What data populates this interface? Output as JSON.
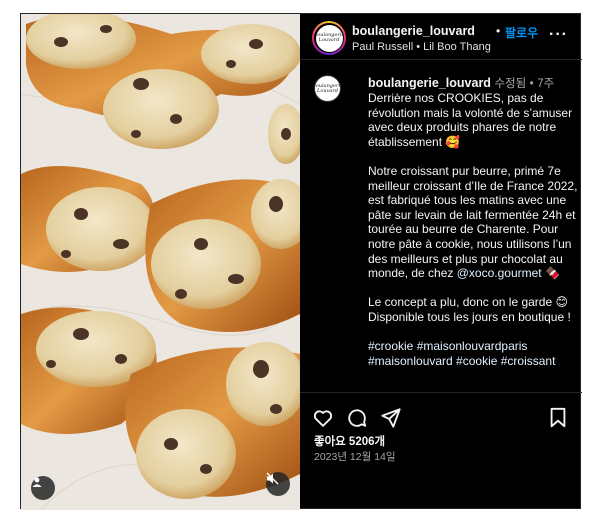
{
  "post": {
    "username": "boulangerie_louvard",
    "follow_label": "팔로우",
    "audio": {
      "artist": "Paul Russell",
      "track": "Lil Boo Thang"
    },
    "logo_text": "Boulangerie Louvard",
    "caption_meta": {
      "edited": "수정됨",
      "time": "7주"
    },
    "caption": {
      "p1": "Derrière nos CROOKIES, pas de révolution mais la volonté de s’amuser avec deux produits phares de notre établissement 🥰",
      "p2": "Notre croissant pur beurre, primé 7e meilleur croissant d’Ile de France 2022, est fabriqué tous les matins avec une pâte sur levain de lait fermentée 24h et tourée au beurre de Charente. Pour notre pâte à cookie, nous utilisons l’un des meilleurs et plus pur chocolat au monde, de chez",
      "mention": "@xoco.gourmet",
      "p2_emoji": "🍫",
      "p3a": "Le concept a plu, donc on le garde 😊",
      "p3b": "Disponible tous les jours en boutique !",
      "hashtags_line1": "#crookie #maisonlouvardparis",
      "hashtags_line2": "#maisonlouvard #cookie #croissant"
    },
    "likes_label": "좋아요 5206개",
    "date": "2023년 12월 14일"
  },
  "icons": {
    "like": "heart-icon",
    "comment": "comment-icon",
    "share": "send-icon",
    "save": "bookmark-icon",
    "more": "more-icon",
    "user": "user-tag-icon",
    "mute": "mute-icon"
  },
  "colors": {
    "background": "#000000",
    "follow": "#0095f6",
    "secondary_text": "#a8a8a8",
    "divider": "#262626"
  }
}
